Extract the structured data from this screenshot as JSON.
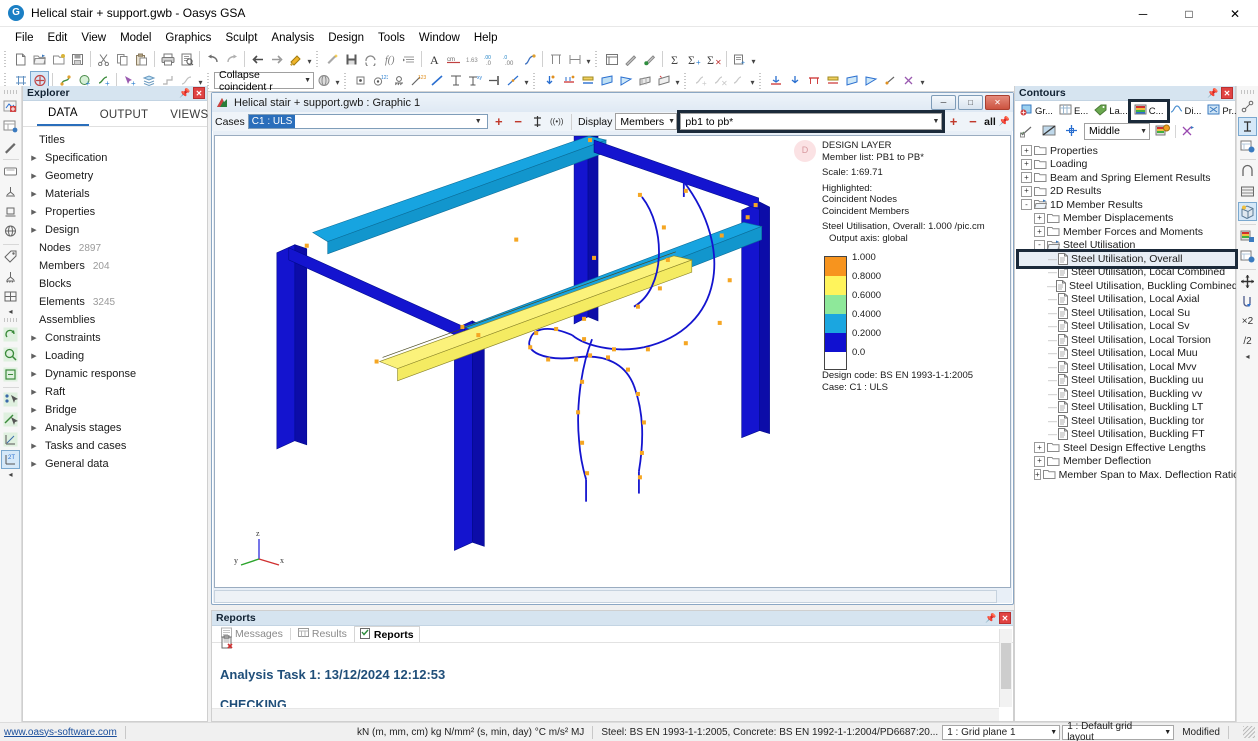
{
  "window": {
    "title": "Helical stair + support.gwb - Oasys GSA",
    "app_icon": "gsa-logo-icon",
    "minimize": "─",
    "maximize": "□",
    "close": "✕"
  },
  "menu": [
    "File",
    "Edit",
    "View",
    "Model",
    "Graphics",
    "Sculpt",
    "Analysis",
    "Design",
    "Tools",
    "Window",
    "Help"
  ],
  "toolbar_row1": {
    "groups": [
      [
        "new-file-icon",
        "open-file-icon",
        "open-recent-icon",
        "save-icon"
      ],
      [
        "cut-icon",
        "copy-icon",
        "paste-icon"
      ],
      [
        "print-icon",
        "print-preview-icon"
      ],
      [
        "undo-icon",
        "redo-icon"
      ],
      [
        "back-icon",
        "forward-icon",
        "format-painter-icon"
      ],
      [
        "wizard-icon",
        "save-data-icon",
        "refresh-icon",
        "function-icon",
        "indent-icon"
      ],
      [
        "font-icon",
        "units-cm-icon",
        "precision-icon",
        "increase-decimal-icon",
        "decrease-decimal-icon",
        "curve-icon"
      ],
      [
        "align-icon",
        "table-icon"
      ],
      [
        "list-icon",
        "edit-pencil-icon",
        "sculpt-icon"
      ],
      [
        "sum-icon",
        "sum-plus-icon",
        "sum-delete-icon"
      ],
      [
        "report-add-icon"
      ]
    ]
  },
  "toolbar_row2": {
    "collapse_combo": "Collapse coincident r",
    "groups": [
      [
        "grid-icon",
        "node-add-icon"
      ],
      [
        "member-icon",
        "element-add-icon",
        "curve-add-icon"
      ],
      [
        "node-select-icon",
        "layers-icon",
        "step-icon",
        "graph-icon"
      ],
      [
        "sphere-icon"
      ],
      [
        "point-icon",
        "node-number-icon",
        "support-icon",
        "element-number-icon",
        "line-icon",
        "axis-icon"
      ],
      [
        "axis-label-icon",
        "snap-end-icon",
        "diagonal-icon"
      ],
      [
        "load-node-icon",
        "load-beam-icon",
        "load-dist-icon",
        "load-area-icon",
        "load-patch-icon",
        "load-grid-icon",
        "load-face-icon"
      ],
      [
        "curve-add2-icon",
        "curve-delete-icon",
        "curve-edit-icon"
      ],
      [
        "restraint-icon",
        "restraint-node-icon",
        "restraint-beam-icon",
        "restraint-area-icon",
        "restraint-tri-icon",
        "restraint-poly-icon",
        "spring-icon",
        "axis-set-icon"
      ]
    ]
  },
  "explorer": {
    "title": "Explorer",
    "pin_icon": "pin-icon",
    "close_icon": "close-icon",
    "tabs": [
      {
        "label": "DATA",
        "active": true
      },
      {
        "label": "OUTPUT",
        "active": false
      },
      {
        "label": "VIEWS",
        "active": false
      }
    ],
    "tree": [
      {
        "label": "Titles",
        "expandable": false,
        "count": ""
      },
      {
        "label": "Specification",
        "expandable": true,
        "count": ""
      },
      {
        "label": "Geometry",
        "expandable": true,
        "count": ""
      },
      {
        "label": "Materials",
        "expandable": true,
        "count": ""
      },
      {
        "label": "Properties",
        "expandable": true,
        "count": ""
      },
      {
        "label": "Design",
        "expandable": true,
        "count": ""
      },
      {
        "label": "Nodes",
        "expandable": false,
        "count": "2897"
      },
      {
        "label": "Members",
        "expandable": false,
        "count": "204"
      },
      {
        "label": "Blocks",
        "expandable": false,
        "count": ""
      },
      {
        "label": "Elements",
        "expandable": false,
        "count": "3245"
      },
      {
        "label": "Assemblies",
        "expandable": false,
        "count": ""
      },
      {
        "label": "Constraints",
        "expandable": true,
        "count": ""
      },
      {
        "label": "Loading",
        "expandable": true,
        "count": ""
      },
      {
        "label": "Dynamic response",
        "expandable": true,
        "count": ""
      },
      {
        "label": "Raft",
        "expandable": true,
        "count": ""
      },
      {
        "label": "Bridge",
        "expandable": true,
        "count": ""
      },
      {
        "label": "Analysis stages",
        "expandable": true,
        "count": ""
      },
      {
        "label": "Tasks and cases",
        "expandable": true,
        "count": ""
      },
      {
        "label": "General data",
        "expandable": true,
        "count": ""
      }
    ]
  },
  "graphic_window": {
    "title": "Helical stair + support.gwb : Graphic 1",
    "minimize": "─",
    "restore": "□",
    "close": "✕",
    "cases_label": "Cases",
    "cases_value": "C1 : ULS",
    "display_label": "Display",
    "display_value": "Members",
    "member_list_value": "pb1 to pb*",
    "member_list_all": "all",
    "plus": "+",
    "minus": "−",
    "scale_icon": "scale-icon",
    "wave_icon": "animate-icon",
    "pin_icon": "pin-icon"
  },
  "legend": {
    "badge": "D",
    "lines": [
      "DESIGN LAYER",
      "Member list: PB1 to PB*",
      "Scale: 1:69.71",
      "Highlighted:",
      "Coincident Nodes",
      "Coincident Members",
      "Steel Utilisation, Overall: 1.000 /pic.cm",
      "Output axis: global"
    ],
    "title": "DESIGN LAYER",
    "member_list": "Member list: PB1 to PB*",
    "scale": "Scale: 1:69.71",
    "highlighted_label": "Highlighted:",
    "highlighted_1": "Coincident Nodes",
    "highlighted_2": "Coincident Members",
    "result": "Steel Utilisation, Overall: 1.000 /pic.cm",
    "output_axis": "Output axis: global",
    "design_code": "Design code: BS EN 1993-1-1:2005",
    "case": "Case: C1 : ULS",
    "scale_ticks": [
      "1.000",
      "0.8000",
      "0.6000",
      "0.4000",
      "0.2000",
      "0.0"
    ],
    "scale_colors": [
      "#f7941e",
      "#fff45c",
      "#8ee89a",
      "#1ba6e0",
      "#1010d0",
      "#0d0db5"
    ]
  },
  "axes": {
    "x": "x",
    "y": "y",
    "z": "z"
  },
  "reports": {
    "title": "Reports",
    "pin_icon": "pin-icon",
    "close_icon": "close-icon",
    "tabs": [
      {
        "label": "Messages",
        "icon": "messages-icon",
        "active": false
      },
      {
        "label": "Results",
        "icon": "results-icon",
        "active": false
      },
      {
        "label": "Reports",
        "icon": "reports-icon",
        "active": true
      }
    ],
    "toolbar_icon": "clipboard-delete-icon",
    "heading": "Analysis Task 1: 13/12/2024 12:12:53",
    "subheading": "CHECKING"
  },
  "contours": {
    "title": "Contours",
    "pin_icon": "pin-icon",
    "close_icon": "close-icon",
    "tabs": [
      {
        "label": "Gr...",
        "icon": "graphic-settings-icon",
        "selected": false
      },
      {
        "label": "E...",
        "icon": "entities-icon",
        "selected": false
      },
      {
        "label": "La...",
        "icon": "labels-icon",
        "selected": false
      },
      {
        "label": "C...",
        "icon": "contours-icon",
        "selected": true
      },
      {
        "label": "Di...",
        "icon": "diagrams-icon",
        "selected": false
      },
      {
        "label": "Pr...",
        "icon": "preferences-icon",
        "selected": false
      }
    ],
    "toolbar": {
      "deform_icon": "deformation-icon",
      "nocontour_icon": "no-contour-icon",
      "centre_icon": "centre-icon",
      "position_value": "Middle",
      "palette_icon": "palette-settings-icon",
      "axis_icon": "output-axis-icon"
    },
    "tree": [
      {
        "label": "Properties",
        "depth": 0,
        "type": "folder",
        "state": "+"
      },
      {
        "label": "Loading",
        "depth": 0,
        "type": "folder",
        "state": "+"
      },
      {
        "label": "Beam and Spring Element Results",
        "depth": 0,
        "type": "folder",
        "state": "+"
      },
      {
        "label": "2D Results",
        "depth": 0,
        "type": "folder",
        "state": "+"
      },
      {
        "label": "1D Member Results",
        "depth": 0,
        "type": "folder-open",
        "state": "-"
      },
      {
        "label": "Member Displacements",
        "depth": 1,
        "type": "folder",
        "state": "+"
      },
      {
        "label": "Member Forces and Moments",
        "depth": 1,
        "type": "folder",
        "state": "+"
      },
      {
        "label": "Steel Utilisation",
        "depth": 1,
        "type": "folder-open",
        "state": "-"
      },
      {
        "label": "Steel Utilisation, Overall",
        "depth": 2,
        "type": "doc",
        "state": "",
        "highlight": true
      },
      {
        "label": "Steel Utilisation, Local Combined",
        "depth": 2,
        "type": "doc",
        "state": ""
      },
      {
        "label": "Steel Utilisation, Buckling Combined",
        "depth": 2,
        "type": "doc",
        "state": ""
      },
      {
        "label": "Steel Utilisation, Local Axial",
        "depth": 2,
        "type": "doc",
        "state": ""
      },
      {
        "label": "Steel Utilisation, Local Su",
        "depth": 2,
        "type": "doc",
        "state": ""
      },
      {
        "label": "Steel Utilisation, Local Sv",
        "depth": 2,
        "type": "doc",
        "state": ""
      },
      {
        "label": "Steel Utilisation, Local Torsion",
        "depth": 2,
        "type": "doc",
        "state": ""
      },
      {
        "label": "Steel Utilisation, Local Muu",
        "depth": 2,
        "type": "doc",
        "state": ""
      },
      {
        "label": "Steel Utilisation, Local Mvv",
        "depth": 2,
        "type": "doc",
        "state": ""
      },
      {
        "label": "Steel Utilisation, Buckling uu",
        "depth": 2,
        "type": "doc",
        "state": ""
      },
      {
        "label": "Steel Utilisation, Buckling vv",
        "depth": 2,
        "type": "doc",
        "state": ""
      },
      {
        "label": "Steel Utilisation, Buckling LT",
        "depth": 2,
        "type": "doc",
        "state": ""
      },
      {
        "label": "Steel Utilisation, Buckling tor",
        "depth": 2,
        "type": "doc",
        "state": ""
      },
      {
        "label": "Steel Utilisation, Buckling FT",
        "depth": 2,
        "type": "doc",
        "state": ""
      },
      {
        "label": "Steel Design Effective Lengths",
        "depth": 1,
        "type": "folder",
        "state": "+"
      },
      {
        "label": "Member Deflection",
        "depth": 1,
        "type": "folder",
        "state": "+"
      },
      {
        "label": "Member Span to Max. Deflection Ratio",
        "depth": 1,
        "type": "folder",
        "state": "+"
      }
    ]
  },
  "right_strip": [
    "link-icon",
    "text-cursor-icon",
    "node-props-icon",
    "arch-icon",
    "shelf-icon",
    "solid-render-icon",
    "contour-fill-icon",
    "contour-props-icon",
    "move-icon",
    "drop-icon"
  ],
  "right_strip_labels": {
    "x2": "×2",
    "div2": "/2"
  },
  "left_strip": [
    "new-model-icon",
    "data-grid-icon",
    "pencil-icon",
    "panel-icon",
    "support-pin-icon",
    "support-roller-icon",
    "globe-icon",
    "tag-icon",
    "support-fix-icon",
    "grid-view-icon",
    "rotate-icon",
    "zoom-icon",
    "box-zoom-icon",
    "select-nodes-icon",
    "select-members-icon",
    "graph-axes-icon",
    "twist-icon"
  ],
  "status_bar": {
    "website": "www.oasys-software.com",
    "units": "kN  (m, mm, cm)  kg  N/mm²  (s, min, day)  °C  m/s²  MJ",
    "codes": "Steel: BS EN 1993-1-1:2005, Concrete: BS EN 1992-1-1:2004/PD6687:20...",
    "grid_plane": "1 : Grid plane 1",
    "grid_layout": "1 : Default grid layout",
    "modified": "Modified"
  }
}
